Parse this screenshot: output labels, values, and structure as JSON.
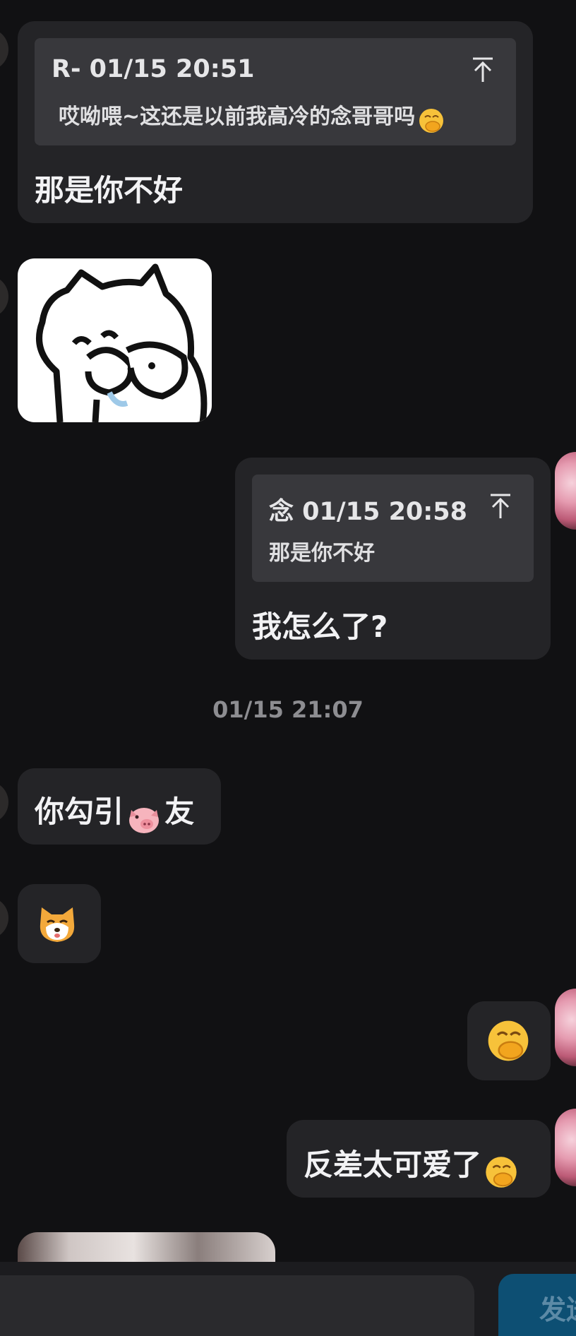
{
  "messages": [
    {
      "reply": {
        "head": "R- 01/15 20:51",
        "text": "哎呦喂~这还是以前我高冷的念哥哥吗"
      },
      "text": "那是你不好"
    },
    {
      "reply": {
        "head": "念 01/15 20:58",
        "text": "那是你不好"
      },
      "text": "我怎么了?"
    },
    {
      "text_before": "你勾引",
      "text_after": "友"
    },
    {
      "text": "反差太可爱了"
    }
  ],
  "timestamp": "01/15 21:07",
  "send_button_label": "发送",
  "icons": {
    "reply_jump": "arrow-to-top-icon",
    "shy_emoji": "hand-over-mouth-emoji",
    "pig_emoji": "pig-face-emoji",
    "shiba_emoji": "shiba-dog-emoji",
    "cat_sticker": "cat-meme-sticker"
  },
  "colors": {
    "background": "#111113",
    "bubble": "#242427",
    "quote": "#38383c",
    "send_button": "#0d4f73"
  }
}
